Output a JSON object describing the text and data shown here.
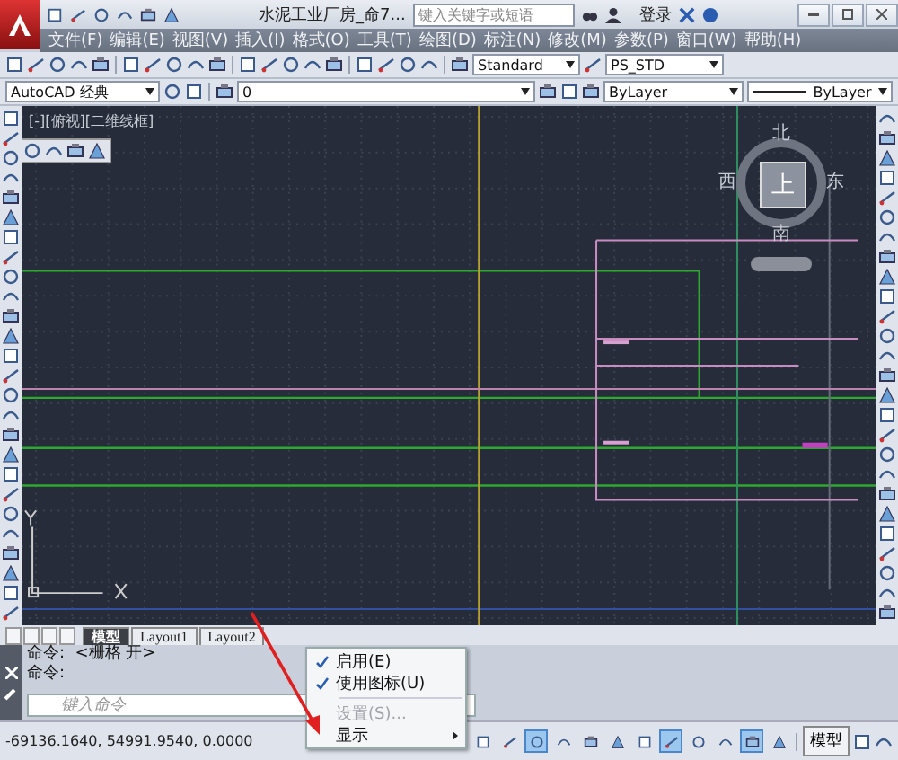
{
  "title_bar": {
    "title": "水泥工业厂房_命7...",
    "search": {
      "placeholder": "键入关键字或短语"
    },
    "sign_in": "登录"
  },
  "menu_bar": [
    "文件(F)",
    "编辑(E)",
    "视图(V)",
    "插入(I)",
    "格式(O)",
    "工具(T)",
    "绘图(D)",
    "标注(N)",
    "修改(M)",
    "参数(P)",
    "窗口(W)",
    "帮助(H)"
  ],
  "toolbar": {
    "text_style": "Standard",
    "table_style": "PS_STD"
  },
  "properties_bar": {
    "workspace": "AutoCAD 经典",
    "layer": "0",
    "color_control": "ByLayer",
    "linetype": "ByLayer"
  },
  "viewport": {
    "label": "[-][俯视][二维线框]",
    "viewcube": {
      "north": "北",
      "west": "西",
      "east": "东",
      "south": "南",
      "face": "上"
    }
  },
  "layout_tabs": [
    {
      "label": "模型",
      "selected": true
    },
    {
      "label": "Layout1",
      "selected": false
    },
    {
      "label": "Layout2",
      "selected": false
    }
  ],
  "command_history": [
    "命令:  <栅格 开>",
    "命令:"
  ],
  "command_input": {
    "placeholder": "键入命令"
  },
  "status_bar": {
    "coordinates": "-69136.1640, 54991.9540, 0.0000",
    "model_button": "模型",
    "toggles": [
      {
        "on": false
      },
      {
        "on": false
      },
      {
        "on": true
      },
      {
        "on": false
      },
      {
        "on": false
      },
      {
        "on": false
      },
      {
        "on": false
      },
      {
        "on": true
      },
      {
        "on": false
      },
      {
        "on": false
      },
      {
        "on": true
      },
      {
        "on": false
      }
    ]
  },
  "context_menu": [
    {
      "kind": "item",
      "label": "启用(E)",
      "checked": true,
      "disabled": false
    },
    {
      "kind": "item",
      "label": "使用图标(U)",
      "checked": true,
      "disabled": false
    },
    {
      "kind": "separator"
    },
    {
      "kind": "item",
      "label": "设置(S)...",
      "checked": false,
      "disabled": true
    },
    {
      "kind": "submenu",
      "label": "显示",
      "checked": false,
      "disabled": false
    }
  ]
}
